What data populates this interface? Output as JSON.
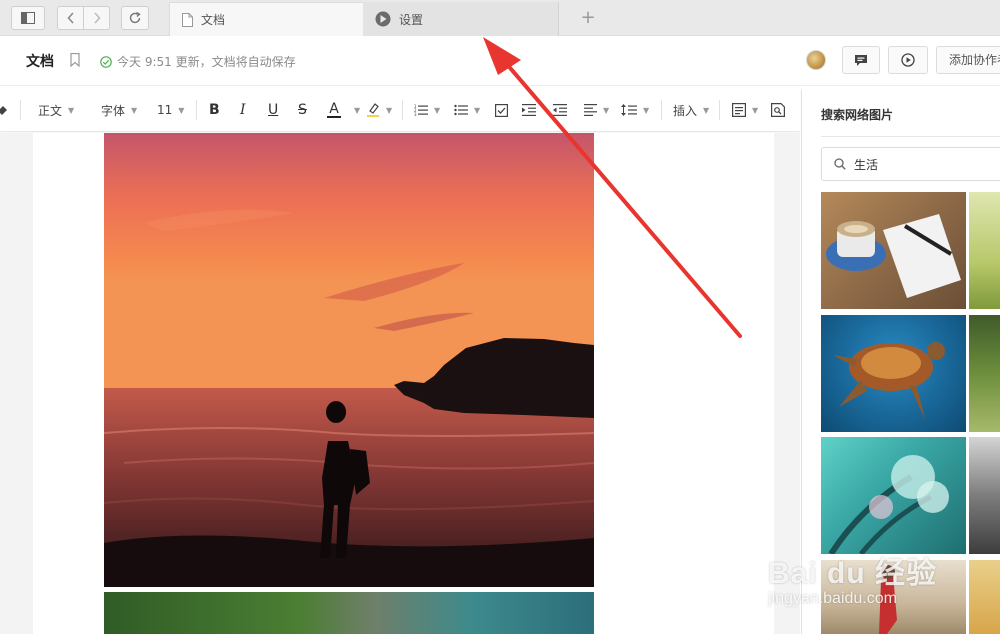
{
  "tabs": [
    {
      "label": "文档",
      "icon": "document-icon",
      "active": true
    },
    {
      "label": "设置",
      "icon": "settings-app-icon",
      "active": false
    }
  ],
  "new_tab_label": "+",
  "header": {
    "title": "文档",
    "save_status": "今天 9:51 更新，文档将自动保存",
    "collaborate_label": "添加协作者"
  },
  "toolbar": {
    "paragraph_style": "正文",
    "font": "字体",
    "font_size": "11",
    "bold": "B",
    "italic": "I",
    "underline": "U",
    "strike": "S",
    "font_color": "A",
    "insert": "插入"
  },
  "panel": {
    "title": "搜索网络图片",
    "search_value": "生活"
  },
  "watermark": {
    "logo": "Bai du 经验",
    "url": "jingyan.baidu.com"
  },
  "colors": {
    "accent_green": "#4caf50",
    "arrow_red": "#e8352f",
    "tabbar_bg": "#e9e9e9"
  }
}
